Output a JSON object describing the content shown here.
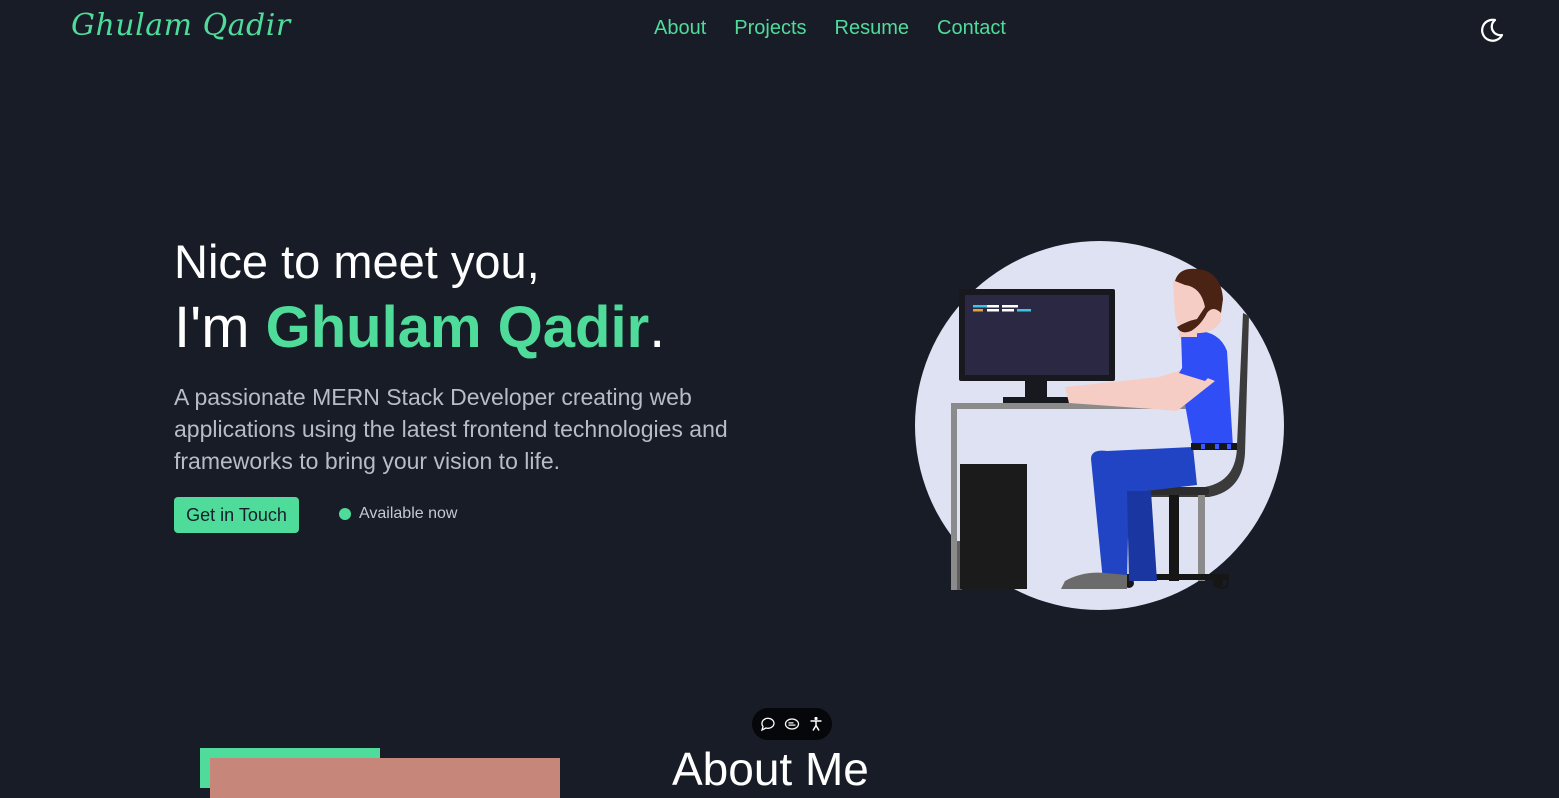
{
  "header": {
    "logo": "Ghulam Qadir",
    "nav": [
      "About",
      "Projects",
      "Resume",
      "Contact"
    ],
    "theme_toggle_icon": "moon-icon"
  },
  "hero": {
    "greeting": "Nice to meet you,",
    "intro_prefix": "I'm",
    "name": "Ghulam Qadir",
    "intro_suffix": ".",
    "description": "A passionate MERN Stack Developer creating web applications using the latest frontend technologies and frameworks to bring your vision to life.",
    "cta_label": "Get in Touch",
    "availability": "Available now",
    "illustration_icon": "developer-at-desk-illustration"
  },
  "floating_toolbar": {
    "icons": [
      "chat-bubble-icon",
      "caption-icon",
      "accessibility-icon"
    ]
  },
  "about": {
    "title": "About Me"
  },
  "colors": {
    "background": "#171c26",
    "accent": "#4fdc9b",
    "text": "#ffffff",
    "muted_text": "#b7bcc5"
  }
}
